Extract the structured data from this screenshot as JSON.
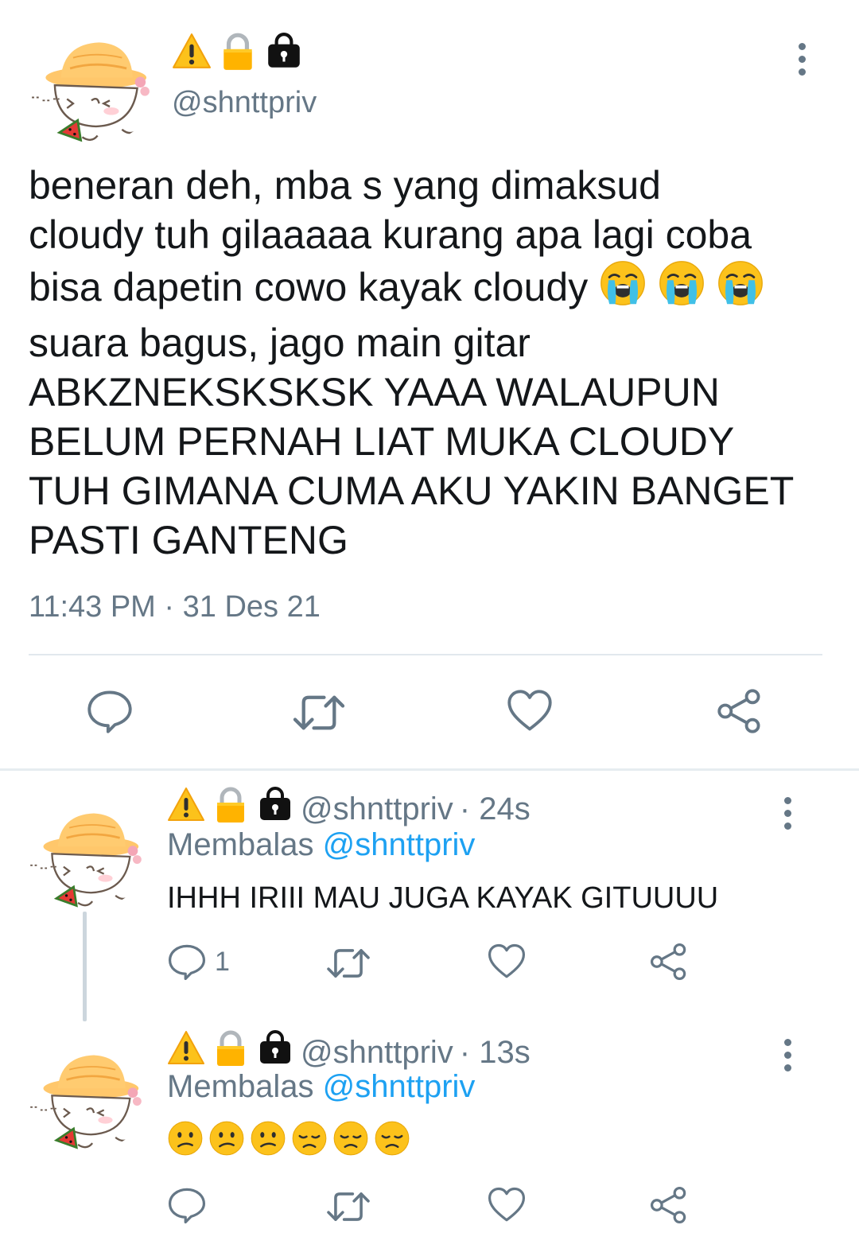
{
  "main_tweet": {
    "handle": "@shnttpriv",
    "text": "beneran deh, mba s yang dimaksud\ncloudy tuh gilaaaaa kurang apa lagi coba\nbisa dapetin cowo kayak cloudy ",
    "text_after_emoji": "\nsuara bagus, jago main gitar\nABKZNEKSKSKSK YAAA WALAUPUN\nBELUM PERNAH LIAT MUKA CLOUDY\nTUH GIMANA CUMA AKU YAKIN BANGET\nPASTI GANTENG",
    "inline_emojis": [
      "loudly-crying-face",
      "loudly-crying-face",
      "loudly-crying-face"
    ],
    "time": "11:43 PM",
    "dot": "·",
    "date": "31 Des 21",
    "actions": [
      "reply",
      "retweet",
      "like",
      "share"
    ]
  },
  "replies": [
    {
      "handle": "@shnttpriv",
      "age": "· 24s",
      "replying_label": "Membalas",
      "mention": "@shnttpriv",
      "text": "IHHH IRIII MAU JUGA KAYAK GITUUUU",
      "reply_count": "1"
    },
    {
      "handle": "@shnttpriv",
      "age": "· 13s",
      "replying_label": "Membalas",
      "mention": "@shnttpriv",
      "emojis": [
        "confused-face",
        "confused-face",
        "confused-face",
        "disappointed-face",
        "disappointed-face",
        "disappointed-face"
      ]
    }
  ],
  "badge_icons": [
    "warning-icon",
    "locked-icon",
    "lock-bag-icon"
  ],
  "colors": {
    "text": "#14171a",
    "muted": "#657786",
    "link": "#1da1f2",
    "divider": "#e1e8ed",
    "icon": "#657786"
  }
}
